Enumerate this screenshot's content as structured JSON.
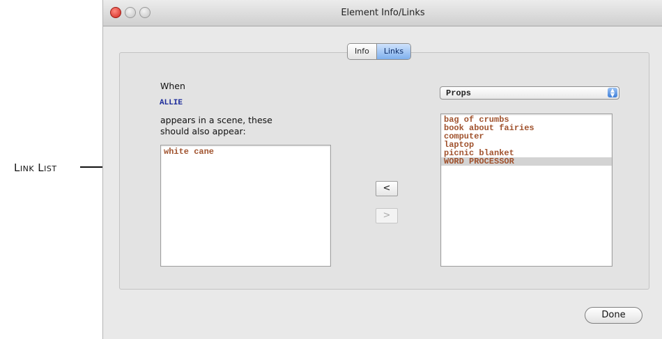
{
  "annotations": {
    "link_list_label": "Link List"
  },
  "window": {
    "title": "Element Info/Links"
  },
  "tabs": [
    {
      "label": "Info",
      "active": false
    },
    {
      "label": "Links",
      "active": true
    }
  ],
  "left": {
    "when_label": "When",
    "element_name": "ALLIE",
    "appears_text_line1": "appears in a scene, these",
    "appears_text_line2": "should also appear:",
    "link_list": [
      "white cane"
    ]
  },
  "right": {
    "category_popup": "Props",
    "items": [
      "bag of crumbs",
      "book about fairies",
      "computer",
      "laptop",
      "picnic blanket",
      "WORD PROCESSOR"
    ],
    "selected_index": 5
  },
  "buttons": {
    "add_left": "<",
    "add_right": ">",
    "done": "Done"
  }
}
